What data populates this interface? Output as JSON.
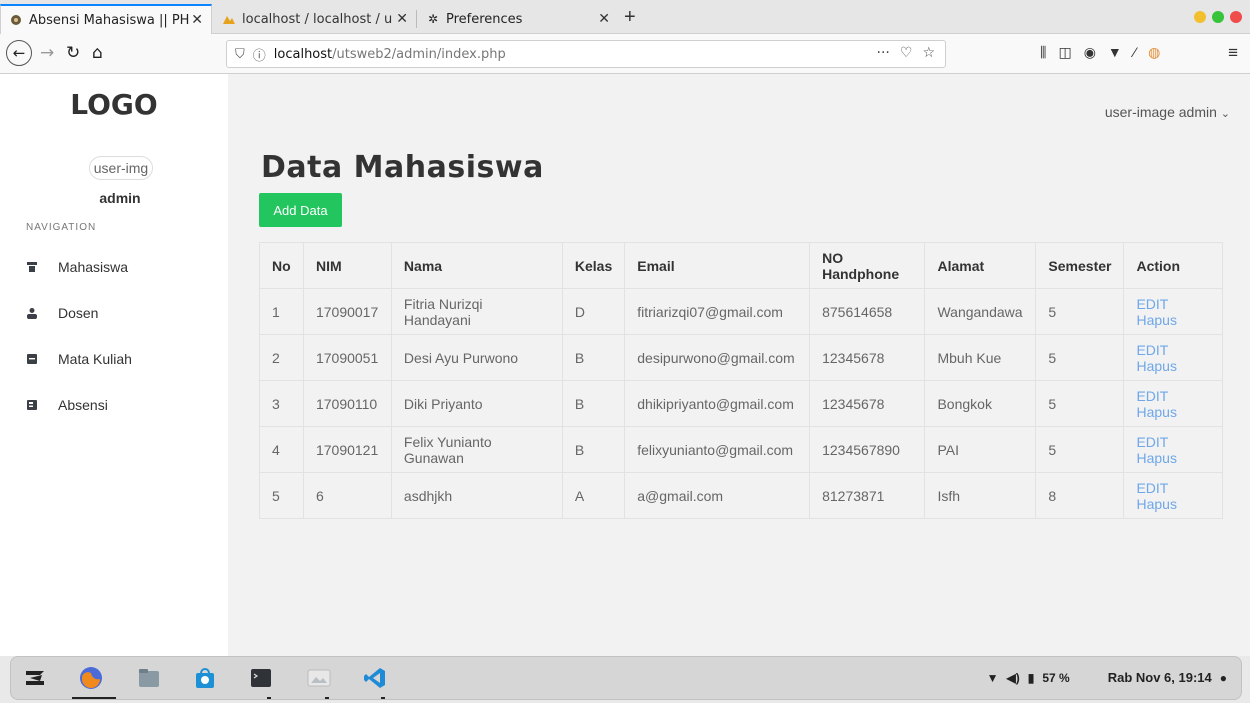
{
  "browser": {
    "tabs": [
      {
        "label": "Absensi Mahasiswa || PHI",
        "active": true
      },
      {
        "label": "localhost / localhost / uts",
        "active": false
      },
      {
        "label": "Preferences",
        "active": false
      }
    ],
    "url_host": "localhost",
    "url_path": "/utsweb2/admin/index.php"
  },
  "sidebar": {
    "logo": "LOGO",
    "user_img": "user-img",
    "user_name": "admin",
    "nav_heading": "NAVIGATION",
    "items": [
      {
        "label": "Mahasiswa",
        "icon": "graduation-cap-icon"
      },
      {
        "label": "Dosen",
        "icon": "person-icon"
      },
      {
        "label": "Mata Kuliah",
        "icon": "book-icon"
      },
      {
        "label": "Absensi",
        "icon": "book-closed-icon"
      }
    ]
  },
  "header": {
    "user_image": "user-image",
    "user_name": "admin"
  },
  "main": {
    "title": "Data Mahasiswa",
    "add_button": "Add Data"
  },
  "table": {
    "columns": [
      "No",
      "NIM",
      "Nama",
      "Kelas",
      "Email",
      "NO Handphone",
      "Alamat",
      "Semester",
      "Action"
    ],
    "rows": [
      [
        "1",
        "17090017",
        "Fitria Nurizqi Handayani",
        "D",
        "fitriarizqi07@gmail.com",
        "875614658",
        "Wangandawa",
        "5"
      ],
      [
        "2",
        "17090051",
        "Desi Ayu Purwono",
        "B",
        "desipurwono@gmail.com",
        "12345678",
        "Mbuh Kue",
        "5"
      ],
      [
        "3",
        "17090110",
        "Diki Priyanto",
        "B",
        "dhikipriyanto@gmail.com",
        "12345678",
        "Bongkok",
        "5"
      ],
      [
        "4",
        "17090121",
        "Felix Yunianto Gunawan",
        "B",
        "felixyunianto@gmail.com",
        "1234567890",
        "PAI",
        "5"
      ],
      [
        "5",
        "6",
        "asdhjkh",
        "A",
        "a@gmail.com",
        "81273871",
        "Isfh",
        "8"
      ]
    ],
    "edit_label": "EDIT",
    "delete_label": "Hapus"
  },
  "taskbar": {
    "battery": "57 %",
    "clock": "Rab Nov 6, 19:14"
  },
  "colors": {
    "accent_green": "#22c55e",
    "link_blue": "#6fa7e9",
    "tab_highlight": "#0a84ff"
  }
}
